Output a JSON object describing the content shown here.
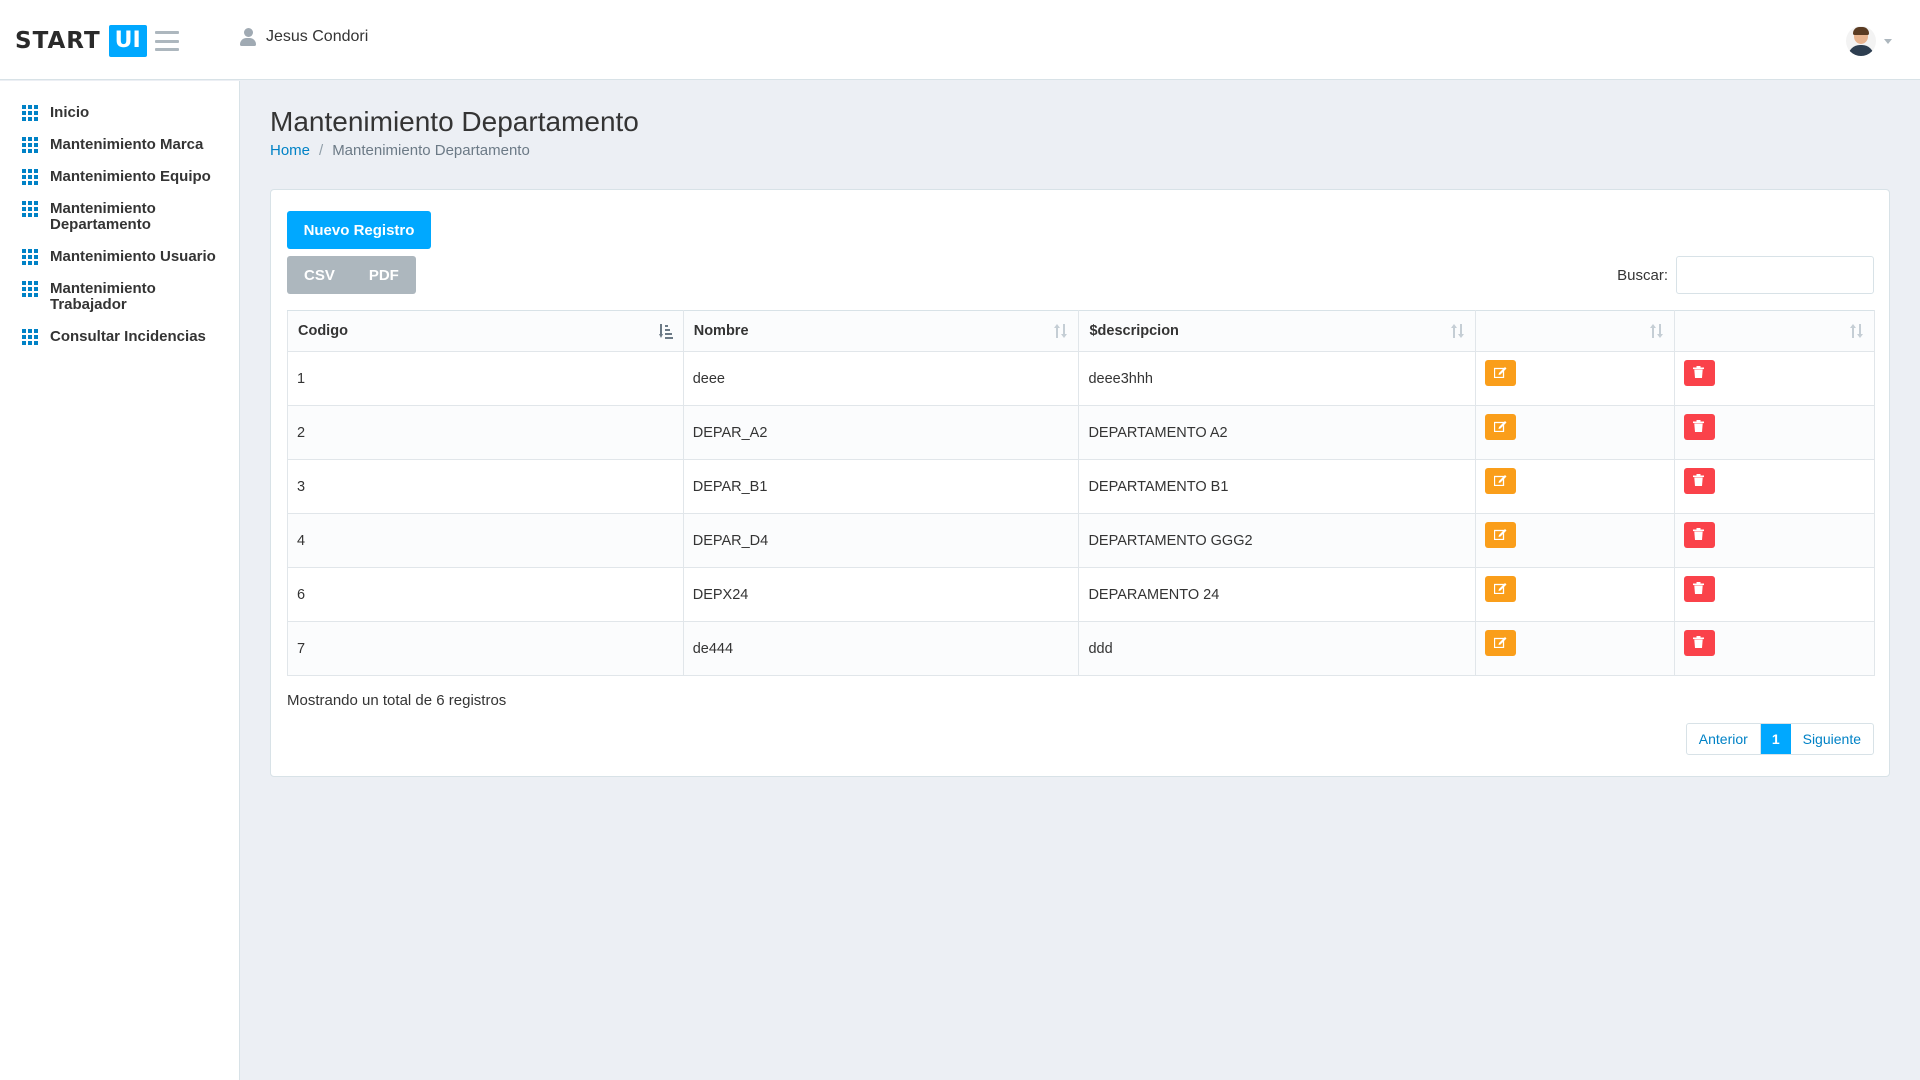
{
  "header": {
    "logo_start": "START",
    "logo_ui": "UI",
    "user_name": "Jesus Condori"
  },
  "sidebar": {
    "items": [
      {
        "label": "Inicio"
      },
      {
        "label": "Mantenimiento Marca"
      },
      {
        "label": "Mantenimiento Equipo"
      },
      {
        "label": "Mantenimiento Departamento"
      },
      {
        "label": "Mantenimiento Usuario"
      },
      {
        "label": "Mantenimiento Trabajador"
      },
      {
        "label": "Consultar Incidencias"
      }
    ]
  },
  "page": {
    "title": "Mantenimiento Departamento",
    "breadcrumb_home": "Home",
    "breadcrumb_current": "Mantenimiento Departamento"
  },
  "toolbar": {
    "new_label": "Nuevo Registro",
    "csv_label": "CSV",
    "pdf_label": "PDF",
    "search_label": "Buscar:",
    "search_value": ""
  },
  "table": {
    "columns": [
      "Codigo",
      "Nombre",
      "$descripcion",
      "",
      ""
    ],
    "rows": [
      {
        "codigo": "1",
        "nombre": "deee",
        "descripcion": "deee3hhh"
      },
      {
        "codigo": "2",
        "nombre": "DEPAR_A2",
        "descripcion": "DEPARTAMENTO A2"
      },
      {
        "codigo": "3",
        "nombre": "DEPAR_B1",
        "descripcion": "DEPARTAMENTO B1"
      },
      {
        "codigo": "4",
        "nombre": "DEPAR_D4",
        "descripcion": "DEPARTAMENTO GGG2"
      },
      {
        "codigo": "6",
        "nombre": "DEPX24",
        "descripcion": "DEPARAMENTO 24"
      },
      {
        "codigo": "7",
        "nombre": "de444",
        "descripcion": "ddd"
      }
    ]
  },
  "footer": {
    "total_text": "Mostrando un total de 6 registros",
    "prev_label": "Anterior",
    "current_page": "1",
    "next_label": "Siguiente"
  },
  "colors": {
    "primary": "#00a8ff",
    "link": "#0082c6",
    "edit": "#fa9e1a",
    "delete": "#fa424a",
    "secondary": "#adb7be"
  }
}
